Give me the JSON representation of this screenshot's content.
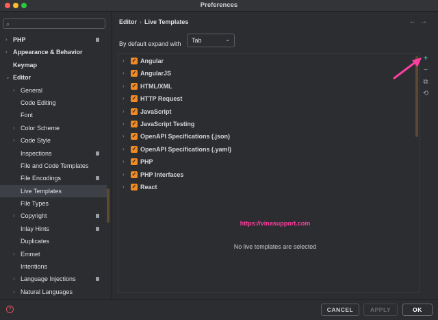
{
  "window": {
    "title": "Preferences"
  },
  "search": {
    "placeholder": "",
    "icon": "search-icon"
  },
  "sidebar": {
    "items": [
      {
        "label": "PHP",
        "arrow": "›",
        "level": 0,
        "badge": true,
        "selected": false,
        "bold": true
      },
      {
        "label": "Appearance & Behavior",
        "arrow": "›",
        "level": 0,
        "badge": false,
        "selected": false,
        "bold": true
      },
      {
        "label": "Keymap",
        "arrow": "",
        "level": 0,
        "badge": false,
        "selected": false,
        "bold": true
      },
      {
        "label": "Editor",
        "arrow": "⌄",
        "level": 0,
        "badge": false,
        "selected": false,
        "bold": true
      },
      {
        "label": "General",
        "arrow": "›",
        "level": 1,
        "badge": false,
        "selected": false,
        "bold": false
      },
      {
        "label": "Code Editing",
        "arrow": "",
        "level": 1,
        "badge": false,
        "selected": false,
        "bold": false
      },
      {
        "label": "Font",
        "arrow": "",
        "level": 1,
        "badge": false,
        "selected": false,
        "bold": false
      },
      {
        "label": "Color Scheme",
        "arrow": "›",
        "level": 1,
        "badge": false,
        "selected": false,
        "bold": false
      },
      {
        "label": "Code Style",
        "arrow": "›",
        "level": 1,
        "badge": false,
        "selected": false,
        "bold": false
      },
      {
        "label": "Inspections",
        "arrow": "",
        "level": 1,
        "badge": true,
        "selected": false,
        "bold": false
      },
      {
        "label": "File and Code Templates",
        "arrow": "",
        "level": 1,
        "badge": false,
        "selected": false,
        "bold": false
      },
      {
        "label": "File Encodings",
        "arrow": "",
        "level": 1,
        "badge": true,
        "selected": false,
        "bold": false
      },
      {
        "label": "Live Templates",
        "arrow": "",
        "level": 1,
        "badge": false,
        "selected": true,
        "bold": false
      },
      {
        "label": "File Types",
        "arrow": "",
        "level": 1,
        "badge": false,
        "selected": false,
        "bold": false
      },
      {
        "label": "Copyright",
        "arrow": "›",
        "level": 1,
        "badge": true,
        "selected": false,
        "bold": false
      },
      {
        "label": "Inlay Hints",
        "arrow": "",
        "level": 1,
        "badge": true,
        "selected": false,
        "bold": false
      },
      {
        "label": "Duplicates",
        "arrow": "",
        "level": 1,
        "badge": false,
        "selected": false,
        "bold": false
      },
      {
        "label": "Emmet",
        "arrow": "›",
        "level": 1,
        "badge": false,
        "selected": false,
        "bold": false
      },
      {
        "label": "Intentions",
        "arrow": "",
        "level": 1,
        "badge": false,
        "selected": false,
        "bold": false
      },
      {
        "label": "Language Injections",
        "arrow": "›",
        "level": 1,
        "badge": true,
        "selected": false,
        "bold": false
      },
      {
        "label": "Natural Languages",
        "arrow": "›",
        "level": 1,
        "badge": false,
        "selected": false,
        "bold": false
      }
    ]
  },
  "header": {
    "breadcrumb": [
      "Editor",
      "Live Templates"
    ],
    "separator": "›",
    "nav_back": "←",
    "nav_forward": "→"
  },
  "settings": {
    "expand_label": "By default expand with",
    "expand_value": "Tab"
  },
  "templates": [
    "Angular",
    "AngularJS",
    "HTML/XML",
    "HTTP Request",
    "JavaScript",
    "JavaScript Testing",
    "OpenAPI Specifications (.json)",
    "OpenAPI Specifications (.yaml)",
    "PHP",
    "PHP Interfaces",
    "React"
  ],
  "toolbar": {
    "add": "+",
    "remove": "−",
    "copy": "⧉",
    "restore": "⟲"
  },
  "watermark": "https://vinasupport.com",
  "empty_message": "No live templates are selected",
  "footer": {
    "cancel": "CANCEL",
    "apply": "APPLY",
    "ok": "OK",
    "help": "?"
  },
  "colors": {
    "accent": "#f08a24",
    "add": "#3fc5b3",
    "annotation": "#ff3fa0",
    "selected_row": "#3d4046"
  }
}
